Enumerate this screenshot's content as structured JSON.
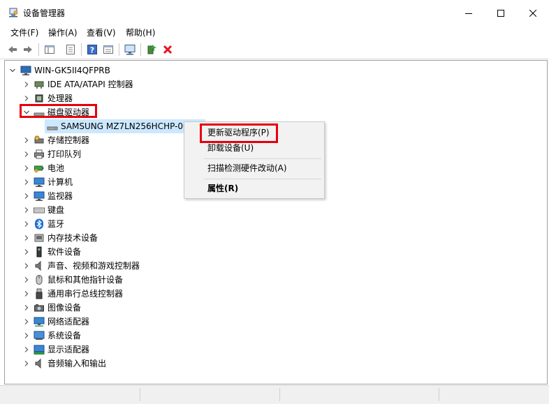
{
  "window": {
    "title": "设备管理器",
    "icon": "device-manager-icon",
    "controls": [
      "minimize-icon",
      "maximize-icon",
      "close-icon"
    ]
  },
  "menu": [
    "文件(F)",
    "操作(A)",
    "查看(V)",
    "帮助(H)"
  ],
  "toolbar": [
    "back-arrow-icon",
    "forward-arrow-icon",
    "show-hide-tree-icon",
    "properties-icon",
    "help-icon",
    "view-icon",
    "scan-hardware-icon",
    "update-driver-icon",
    "uninstall-icon"
  ],
  "tree": {
    "root": "WIN-GK5II4QFPRB",
    "categories": [
      {
        "label": "IDE ATA/ATAPI 控制器",
        "icon": "ide-controller-icon",
        "expanded": false
      },
      {
        "label": "处理器",
        "icon": "processor-icon",
        "expanded": false
      },
      {
        "label": "磁盘驱动器",
        "icon": "disk-drive-icon",
        "expanded": true,
        "children": [
          "SAMSUNG MZ7LN256HCHP-000L7"
        ]
      },
      {
        "label": "存储控制器",
        "icon": "storage-controller-icon",
        "expanded": false
      },
      {
        "label": "打印队列",
        "icon": "printer-icon",
        "expanded": false
      },
      {
        "label": "电池",
        "icon": "battery-icon",
        "expanded": false
      },
      {
        "label": "计算机",
        "icon": "computer-icon",
        "expanded": false
      },
      {
        "label": "监视器",
        "icon": "monitor-icon",
        "expanded": false
      },
      {
        "label": "键盘",
        "icon": "keyboard-icon",
        "expanded": false
      },
      {
        "label": "蓝牙",
        "icon": "bluetooth-icon",
        "expanded": false
      },
      {
        "label": "内存技术设备",
        "icon": "memory-device-icon",
        "expanded": false
      },
      {
        "label": "软件设备",
        "icon": "software-device-icon",
        "expanded": false
      },
      {
        "label": "声音、视频和游戏控制器",
        "icon": "sound-icon",
        "expanded": false
      },
      {
        "label": "鼠标和其他指针设备",
        "icon": "mouse-icon",
        "expanded": false
      },
      {
        "label": "通用串行总线控制器",
        "icon": "usb-icon",
        "expanded": false
      },
      {
        "label": "图像设备",
        "icon": "camera-icon",
        "expanded": false
      },
      {
        "label": "网络适配器",
        "icon": "network-adapter-icon",
        "expanded": false
      },
      {
        "label": "系统设备",
        "icon": "system-device-icon",
        "expanded": false
      },
      {
        "label": "显示适配器",
        "icon": "display-adapter-icon",
        "expanded": false
      },
      {
        "label": "音频输入和输出",
        "icon": "audio-io-icon",
        "expanded": false
      }
    ]
  },
  "context_menu": {
    "items": [
      "更新驱动程序(P)",
      "卸载设备(U)",
      "扫描检测硬件改动(A)",
      "属性(R)"
    ]
  },
  "colors": {
    "highlight": "#e8000b",
    "selection": "#cce8ff",
    "accent": "#0078d7"
  }
}
